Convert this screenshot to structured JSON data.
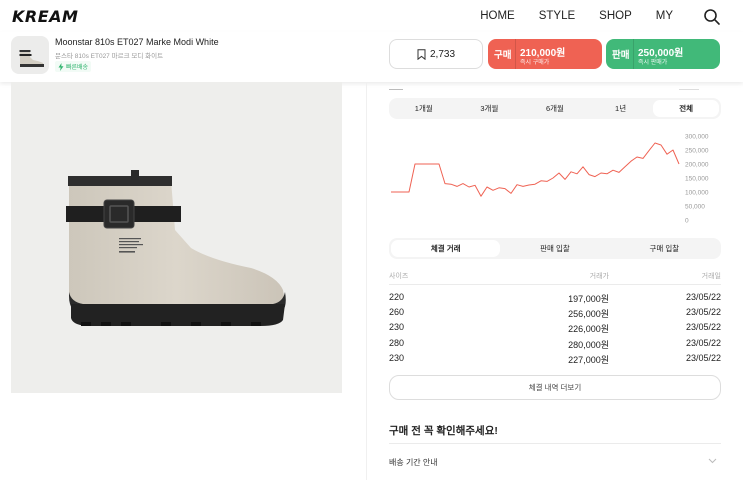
{
  "header": {
    "logo": "KREAM",
    "nav": [
      "HOME",
      "STYLE",
      "SHOP",
      "MY"
    ],
    "search_icon": "search-icon"
  },
  "product": {
    "name": "Moonstar 810s ET027 Marke Modi White",
    "name_ko": "문스타 810s ET027 마르크 모디 화이트",
    "fast_badge": "빠른배송",
    "wish_count": "2,733"
  },
  "actions": {
    "buy": {
      "label": "구매",
      "price": "210,000원",
      "sub": "즉시 구매가"
    },
    "sell": {
      "label": "판매",
      "price": "250,000원",
      "sub": "즉시 판매가"
    }
  },
  "colors": {
    "buy": "#ef6253",
    "sell": "#41b979",
    "line": "#ef6253"
  },
  "period_tabs": [
    "1개월",
    "3개월",
    "6개월",
    "1년",
    "전체"
  ],
  "period_active": 4,
  "chart_data": {
    "type": "line",
    "y_ticks": [
      "300,000",
      "250,000",
      "200,000",
      "150,000",
      "100,000",
      "50,000",
      "0"
    ],
    "ylim": [
      0,
      300000
    ],
    "series": [
      {
        "values": [
          100000,
          100000,
          100000,
          100000,
          200000,
          200000,
          200000,
          200000,
          200000,
          130000,
          128000,
          120000,
          130000,
          118000,
          124000,
          85000,
          118000,
          106000,
          115000,
          112000,
          95000,
          126000,
          120000,
          125000,
          128000,
          140000,
          138000,
          150000,
          168000,
          145000,
          172000,
          165000,
          190000,
          162000,
          155000,
          168000,
          165000,
          178000,
          170000,
          190000,
          210000,
          225000,
          220000,
          248000,
          275000,
          268000,
          235000,
          250000,
          200000
        ]
      }
    ]
  },
  "trade_tabs": [
    "체결 거래",
    "판매 입찰",
    "구매 입찰"
  ],
  "trade_active": 0,
  "table": {
    "headers": [
      "사이즈",
      "거래가",
      "거래일"
    ],
    "rows": [
      [
        "220",
        "197,000원",
        "23/05/22"
      ],
      [
        "260",
        "256,000원",
        "23/05/22"
      ],
      [
        "230",
        "226,000원",
        "23/05/22"
      ],
      [
        "280",
        "280,000원",
        "23/05/22"
      ],
      [
        "230",
        "227,000원",
        "23/05/22"
      ]
    ]
  },
  "more_label": "체결 내역 더보기",
  "notice": {
    "title": "구매 전 꼭 확인해주세요!",
    "items": [
      "배송 기간 안내"
    ]
  }
}
